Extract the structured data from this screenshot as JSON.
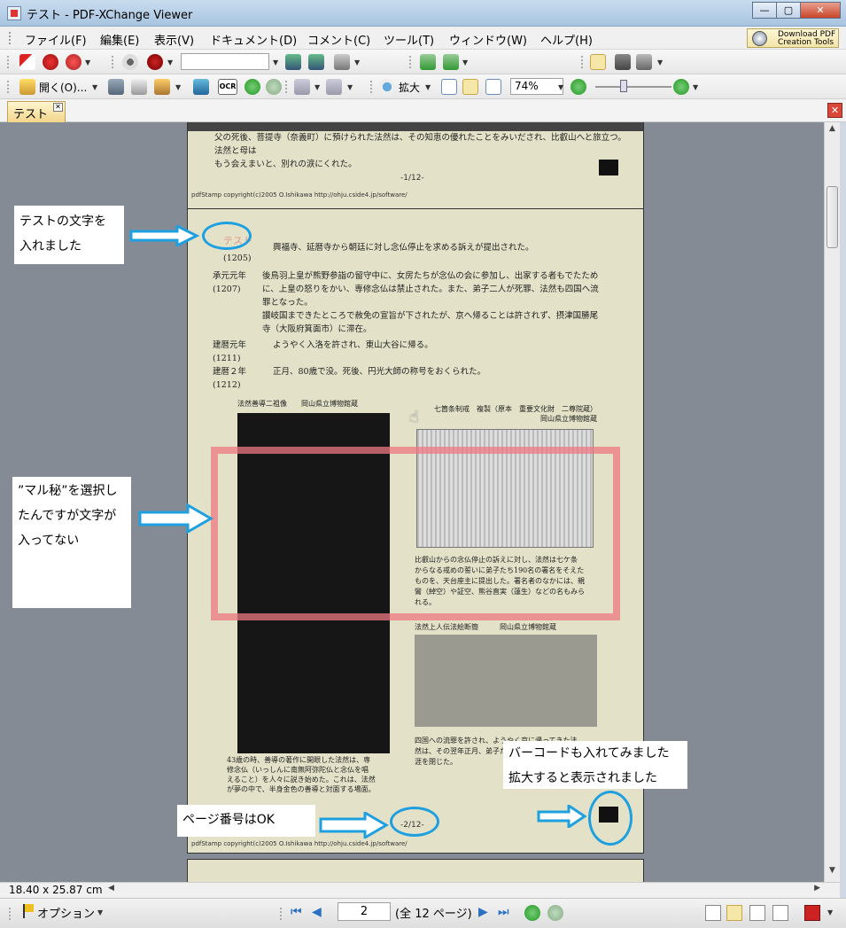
{
  "window": {
    "title": "テスト - PDF-XChange Viewer",
    "min": "—",
    "max": "▢",
    "close": "✕"
  },
  "menu": [
    "ファイル(F)",
    "編集(E)",
    "表示(V)",
    "ドキュメント(D)",
    "コメント(C)",
    "ツール(T)",
    "ウィンドウ(W)",
    "ヘルプ(H)"
  ],
  "download_pdf": {
    "line1": "Download PDF",
    "line2": "Creation Tools"
  },
  "toolbar": {
    "open_label": "開く(O)...",
    "ocr_label": "OCR",
    "zoom_in_label": "拡大",
    "zoom_value": "74%",
    "search_value": ""
  },
  "tab": {
    "label": "テスト",
    "close": "✕"
  },
  "document": {
    "page1": {
      "text": "父の死後、菩提寺（奈義町）に預けられた法然は、その知恵の優れたことをみいだされ、比叡山へと旅立つ。法然と母は\nもう会えまいと、別れの涙にくれた。",
      "page_number": "-1/12-",
      "stamp": "pdfStamp copyright(c)2005 O.Ishikawa http://ohju.cside4.jp/software/"
    },
    "page2": {
      "stamp_text": "テスト",
      "rows": [
        {
          "year": "(1205)",
          "text": "興福寺、延暦寺から朝廷に対し念仏停止を求める訴えが提出された。"
        },
        {
          "year": "承元元年\n(1207)",
          "text": "後鳥羽上皇が熊野参詣の留守中に、女房たちが念仏の会に参加し、出家する者もでたため\nに、上皇の怒りをかい、専修念仏は禁止された。また、弟子二人が死罪、法然も四国へ流\n罪となった。\n讃岐国まできたところで赦免の宣旨が下されたが、京へ帰ることは許されず、摂津国勝尾\n寺（大阪府箕面市）に滞在。"
        },
        {
          "year": "建暦元年\n(1211)",
          "text": "ようやく入洛を許され、東山大谷に帰る。"
        },
        {
          "year": "建暦２年\n(1212)",
          "text": "正月、80歳で没。死後、円光大師の称号をおくられた。"
        }
      ],
      "fig1_caption": "法然善導二祖像　　岡山県立博物館蔵",
      "fig2_caption": "七箇条制戒　複製（原本　重要文化財　二尊院蔵）\n岡山県立博物館蔵",
      "fig2_text": "比叡山からの念仏停止の訴えに対し、法然は七ケ条\nからなる戒めの誓いに弟子たち190名の署名をそえた\nものを、天台座主に提出した。署名者のなかには、親\n鸞（綽空）や証空、熊谷直実（蓮生）などの名もみら\nれる。",
      "fig3_caption": "法然上人伝法絵断簡　　　岡山県立博物館蔵",
      "fig3_text": "四国への流罪を許され、ようやく京に帰ってきた法\n然は、その翌年正月、弟子たちに見守られながら生\n涯を閉じた。",
      "fig1_text": "43歳の時、善導の著作に開眼した法然は、専\n修念仏（いっしんに南無阿弥陀仏と念仏を唱\nえること）を人々に説き始めた。これは、法然\nが夢の中で、半身金色の善導と対面する場面。",
      "page_number": "-2/12-",
      "stamp": "pdfStamp copyright(c)2005 O.Ishikawa http://ohju.cside4.jp/software/"
    },
    "dimensions": "18.40 x 25.87 cm"
  },
  "annotations": {
    "a1": [
      "テストの文字を",
      "入れました"
    ],
    "a2": [
      "”マル秘”を選択し",
      "たんですが文字が",
      "入ってない"
    ],
    "a3": [
      "バーコードも入れてみました",
      "拡大すると表示されました"
    ],
    "a4": "ページ番号はOK"
  },
  "statusbar": {
    "options_label": "オプション",
    "page_current": "2",
    "page_total": "(全 12 ページ)"
  },
  "colors": {
    "annotation_blue": "#1ea0e0",
    "accent_red": "#ee7882"
  }
}
